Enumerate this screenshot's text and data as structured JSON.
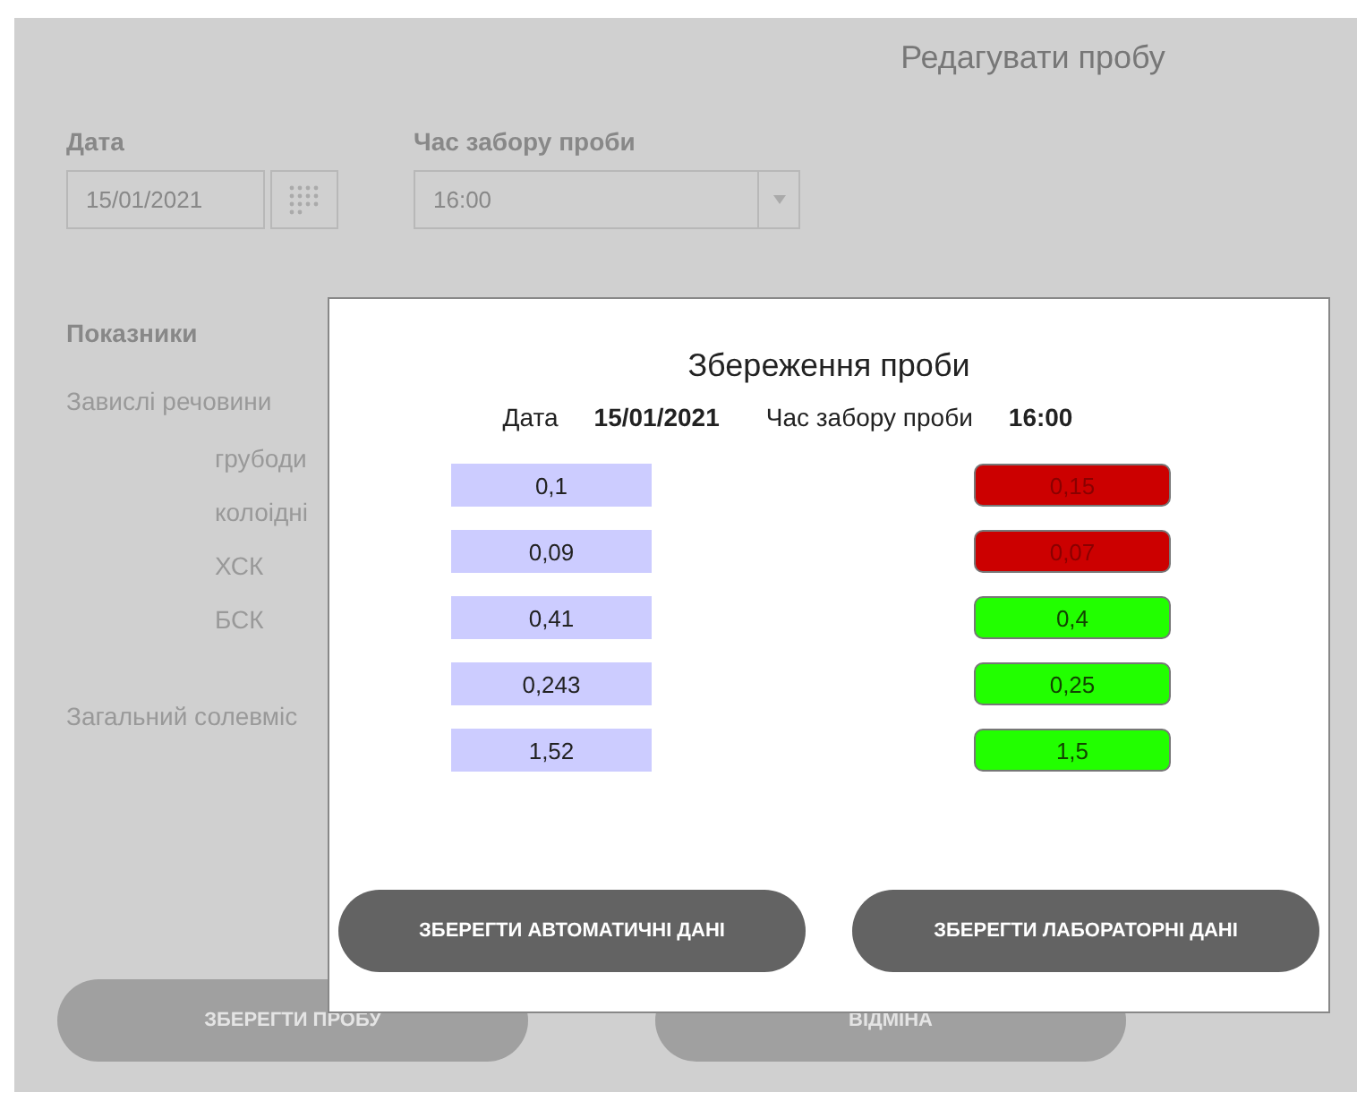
{
  "page": {
    "title": "Редагувати пробу",
    "date": {
      "label": "Дата",
      "value": "15/01/2021"
    },
    "time": {
      "label": "Час забору проби",
      "value": "16:00"
    },
    "indicators_heading": "Показники",
    "indicators": [
      {
        "label": "Завислі речовини",
        "children": [
          {
            "label": "грубоди"
          },
          {
            "label": "колоідні"
          },
          {
            "label": "ХСК"
          },
          {
            "label": "БСК"
          }
        ]
      },
      {
        "label": "Загальний солевміс"
      }
    ],
    "buttons": [
      "ЗБЕРЕГТИ ПРОБУ",
      "ВІДМІНА"
    ]
  },
  "dialog": {
    "title": "Збереження проби",
    "date_label": "Дата",
    "date_value": "15/01/2021",
    "time_label": "Час забору проби",
    "time_value": "16:00",
    "rows": [
      {
        "auto": "0,1",
        "lab": "0,15",
        "color": "#cc0000"
      },
      {
        "auto": "0,09",
        "lab": "0,07",
        "color": "#cc0000"
      },
      {
        "auto": "0,41",
        "lab": "0,4",
        "color": "#22ff00"
      },
      {
        "auto": "0,243",
        "lab": "0,25",
        "color": "#22ff00"
      },
      {
        "auto": "1,52",
        "lab": "1,5",
        "color": "#22ff00"
      }
    ],
    "buttons": [
      "ЗБЕРЕГТИ АВТОМАТИЧНІ ДАНІ",
      "ЗБЕРЕГТИ ЛАБОРАТОРНІ ДАНІ"
    ]
  }
}
